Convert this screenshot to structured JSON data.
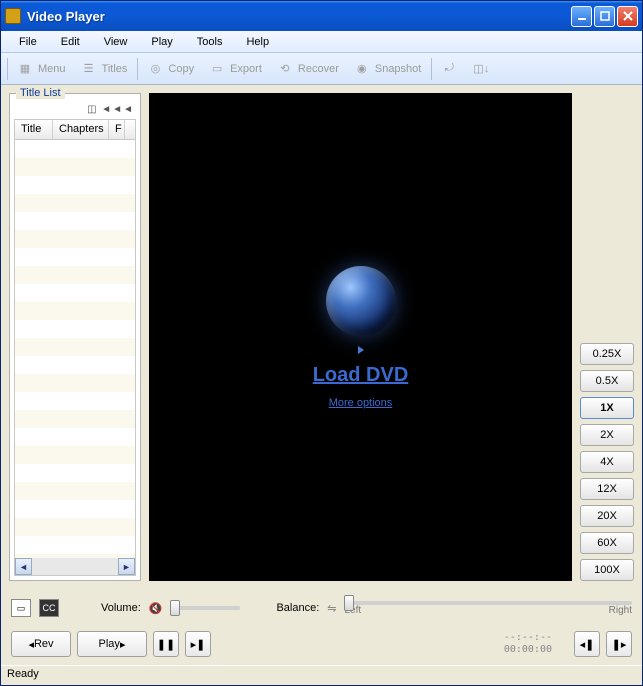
{
  "window": {
    "title": "Video Player"
  },
  "menu": {
    "file": "File",
    "edit": "Edit",
    "view": "View",
    "play": "Play",
    "tools": "Tools",
    "help": "Help"
  },
  "toolbar": {
    "menu": "Menu",
    "titles": "Titles",
    "copy": "Copy",
    "export": "Export",
    "recover": "Recover",
    "snapshot": "Snapshot"
  },
  "titlelist": {
    "legend": "Title List",
    "controls": "◫ ◄◄◄",
    "col_title": "Title",
    "col_chapters": "Chapters",
    "col_r": "F"
  },
  "video": {
    "load": "Load DVD",
    "more": "More options"
  },
  "speeds": [
    "0.25X",
    "0.5X",
    "1X",
    "2X",
    "4X",
    "12X",
    "20X",
    "60X",
    "100X"
  ],
  "speed_active": "1X",
  "volume": {
    "label": "Volume:"
  },
  "balance": {
    "label": "Balance:",
    "left": "Left",
    "right": "Right"
  },
  "cc": "CC",
  "play": {
    "rev": "Rev",
    "play": "Play",
    "pause_icon": "❚❚",
    "next_icon": "▸❚",
    "prev_frame": "◂❚",
    "next_frame": "❚▸"
  },
  "time": {
    "dashes": "--:--:--",
    "zeros": "00:00:00"
  },
  "status": "Ready"
}
